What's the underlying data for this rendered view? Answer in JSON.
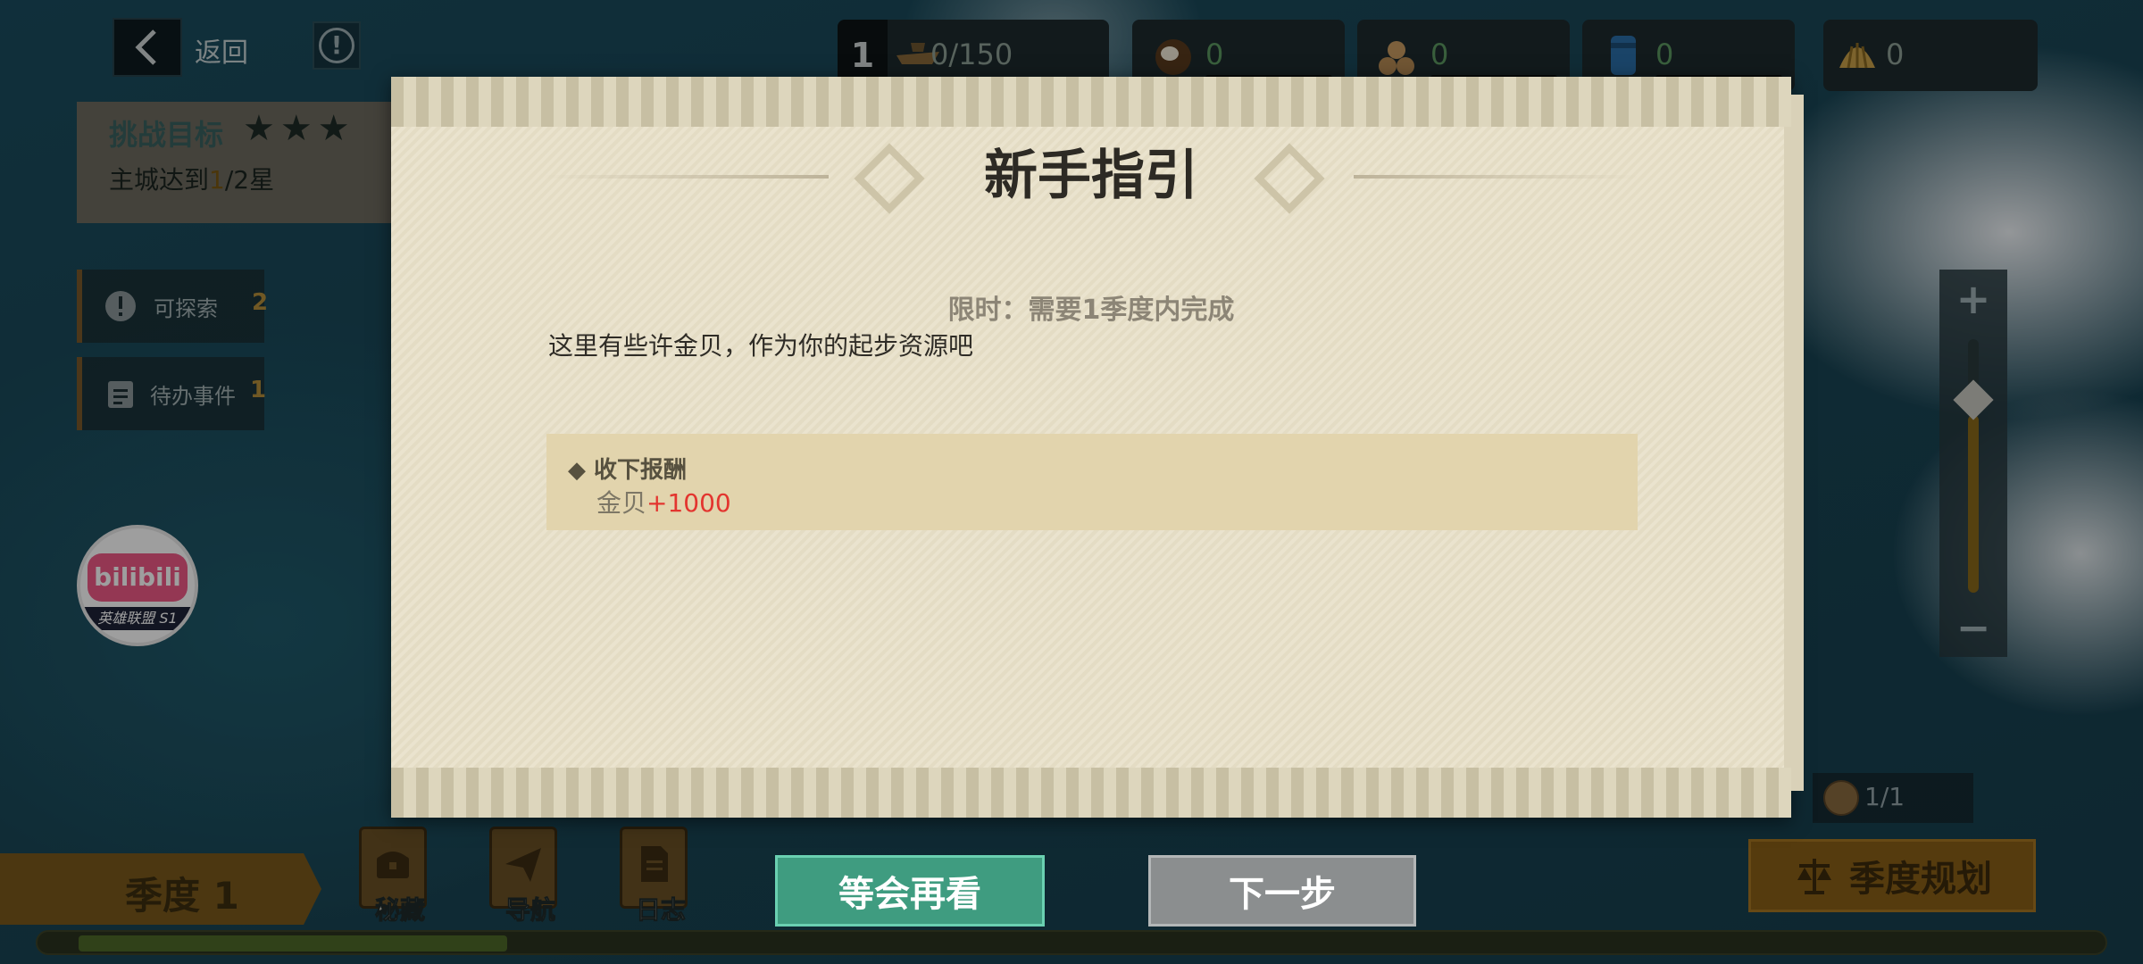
{
  "topbar": {
    "back_label": "返回",
    "level": "1",
    "ship_count": "0/150",
    "resources": [
      {
        "icon": "coconut-icon",
        "value": "0"
      },
      {
        "icon": "wood-logs-icon",
        "value": "0"
      },
      {
        "icon": "water-barrel-icon",
        "value": "0"
      },
      {
        "icon": "shell-icon",
        "value": "0"
      }
    ]
  },
  "challenge": {
    "title": "挑战目标",
    "desc_prefix": "主城达到",
    "desc_highlight": "1",
    "desc_suffix": "/2星"
  },
  "sidebar": {
    "explore_label": "可探索",
    "explore_count": "2",
    "todo_label": "待办事件",
    "todo_count": "1"
  },
  "overlay": {
    "bili_text": "bilibili",
    "bili_sub": "英雄联盟 S1"
  },
  "map": {
    "sail_count": "1/1"
  },
  "bottom": {
    "season_label": "季度 1",
    "buttons": [
      {
        "label": "秘藏",
        "icon": "treasure-chest-icon"
      },
      {
        "label": "导航",
        "icon": "paper-plane-icon"
      },
      {
        "label": "日志",
        "icon": "log-document-icon"
      }
    ],
    "plan_label": "季度规划"
  },
  "dialog": {
    "title": "新手指引",
    "limit_text": "限时：需要1季度内完成",
    "description": "这里有些许金贝，作为你的起步资源吧",
    "reward_heading": "◆ 收下报酬",
    "reward_item": "金贝",
    "reward_amount": "+1000",
    "wait_button": "等会再看",
    "next_button": "下一步"
  },
  "colors": {
    "reward_amount": "#e3352f",
    "wait_button": "#3f9c80",
    "next_button": "#8b8e8f",
    "dialog_bg": "#e8e0c8"
  }
}
